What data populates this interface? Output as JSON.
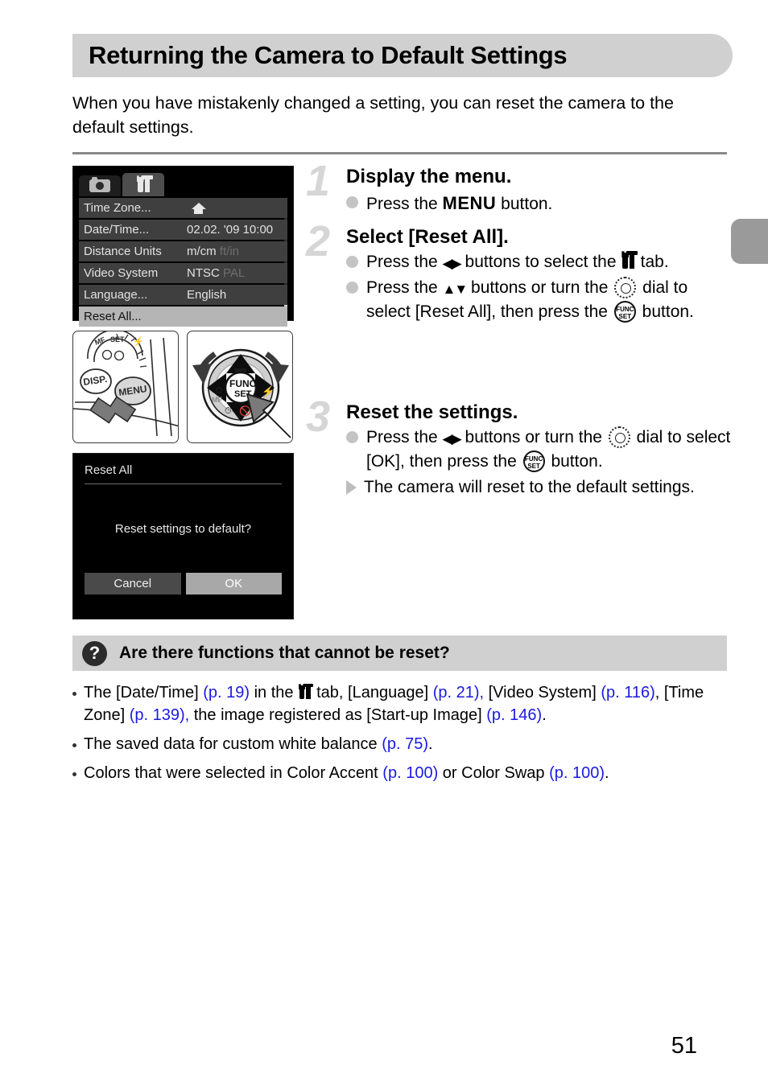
{
  "page": {
    "title": "Returning the Camera to Default Settings",
    "intro": "When you have mistakenly changed a setting, you can reset the camera to the default settings.",
    "page_number": "51"
  },
  "menu_screen": {
    "tabs": [
      {
        "icon": "camera-icon",
        "active": false
      },
      {
        "icon": "tools-icon",
        "active": true
      }
    ],
    "rows": [
      {
        "label": "Time Zone...",
        "value": "",
        "value_icon": "home-icon",
        "selected": false
      },
      {
        "label": "Date/Time...",
        "value": "02.02. '09 10:00",
        "selected": false
      },
      {
        "label": "Distance Units",
        "value": "m/cm",
        "dim_value": "ft/in",
        "selected": false
      },
      {
        "label": "Video System",
        "value": "NTSC",
        "dim_value": "PAL",
        "selected": false
      },
      {
        "label": "Language...",
        "value": "English",
        "selected": false
      },
      {
        "label": "Reset All...",
        "value": "",
        "selected": true
      }
    ]
  },
  "diagrams": {
    "menu_button": {
      "name": "MENU",
      "secondary": "DISP."
    },
    "control_dial": {
      "center_top": "FUNC",
      "center_bottom": "SET"
    }
  },
  "dialog_screen": {
    "title": "Reset All",
    "message": "Reset settings to default?",
    "cancel_label": "Cancel",
    "ok_label": "OK"
  },
  "steps": [
    {
      "number": "1",
      "title": "Display the menu.",
      "lines": [
        {
          "marker": "dot",
          "parts": [
            {
              "t": "text",
              "v": "Press the "
            },
            {
              "t": "menu-glyph",
              "v": "MENU"
            },
            {
              "t": "text",
              "v": " button."
            }
          ]
        }
      ]
    },
    {
      "number": "2",
      "title": "Select [Reset All].",
      "lines": [
        {
          "marker": "dot",
          "parts": [
            {
              "t": "text",
              "v": "Press the "
            },
            {
              "t": "lr-glyph",
              "v": "◀▶"
            },
            {
              "t": "text",
              "v": " buttons to select the "
            },
            {
              "t": "tools-glyph",
              "v": ""
            },
            {
              "t": "text",
              "v": " tab."
            }
          ]
        },
        {
          "marker": "dot",
          "parts": [
            {
              "t": "text",
              "v": "Press the "
            },
            {
              "t": "ud-glyph",
              "v": "▲▼"
            },
            {
              "t": "text",
              "v": " buttons or turn the "
            },
            {
              "t": "dial-glyph",
              "v": ""
            },
            {
              "t": "text",
              "v": " dial to select [Reset All], then press the "
            },
            {
              "t": "func-glyph",
              "v": ""
            },
            {
              "t": "text",
              "v": " button."
            }
          ]
        }
      ]
    },
    {
      "number": "3",
      "title": "Reset the settings.",
      "lines": [
        {
          "marker": "dot",
          "parts": [
            {
              "t": "text",
              "v": "Press the "
            },
            {
              "t": "lr-glyph",
              "v": "◀▶"
            },
            {
              "t": "text",
              "v": " buttons or turn the "
            },
            {
              "t": "dial-glyph",
              "v": ""
            },
            {
              "t": "text",
              "v": " dial to select [OK], then press the "
            },
            {
              "t": "func-glyph",
              "v": ""
            },
            {
              "t": "text",
              "v": " button."
            }
          ]
        },
        {
          "marker": "triangle",
          "parts": [
            {
              "t": "text",
              "v": "The camera will reset to the default settings."
            }
          ]
        }
      ]
    }
  ],
  "tip": {
    "icon": "question-icon",
    "title": "Are there functions that cannot be reset?",
    "items": [
      {
        "parts": [
          {
            "t": "text",
            "v": "The [Date/Time] "
          },
          {
            "t": "ref",
            "v": "(p. 19)"
          },
          {
            "t": "text",
            "v": " in the "
          },
          {
            "t": "tools-glyph-sm",
            "v": ""
          },
          {
            "t": "text",
            "v": " tab, [Language] "
          },
          {
            "t": "ref",
            "v": "(p. 21),"
          },
          {
            "t": "text",
            "v": " [Video System] "
          },
          {
            "t": "ref",
            "v": "(p. 116)"
          },
          {
            "t": "text",
            "v": ", [Time Zone] "
          },
          {
            "t": "ref",
            "v": "(p. 139),"
          },
          {
            "t": "text",
            "v": " the image registered as [Start-up Image] "
          },
          {
            "t": "ref",
            "v": "(p. 146)"
          },
          {
            "t": "text",
            "v": "."
          }
        ]
      },
      {
        "parts": [
          {
            "t": "text",
            "v": "The saved data for custom white balance "
          },
          {
            "t": "ref",
            "v": "(p. 75)"
          },
          {
            "t": "text",
            "v": "."
          }
        ]
      },
      {
        "parts": [
          {
            "t": "text",
            "v": "Colors that were selected in Color Accent "
          },
          {
            "t": "ref",
            "v": "(p. 100)"
          },
          {
            "t": "text",
            "v": " or Color Swap "
          },
          {
            "t": "ref",
            "v": "(p. 100)"
          },
          {
            "t": "text",
            "v": "."
          }
        ]
      }
    ]
  },
  "colors": {
    "banner": "#d0d0d0",
    "reference_link": "#1a1ae0",
    "step_number": "#d6d6d6",
    "rule": "#8a8a8a"
  }
}
